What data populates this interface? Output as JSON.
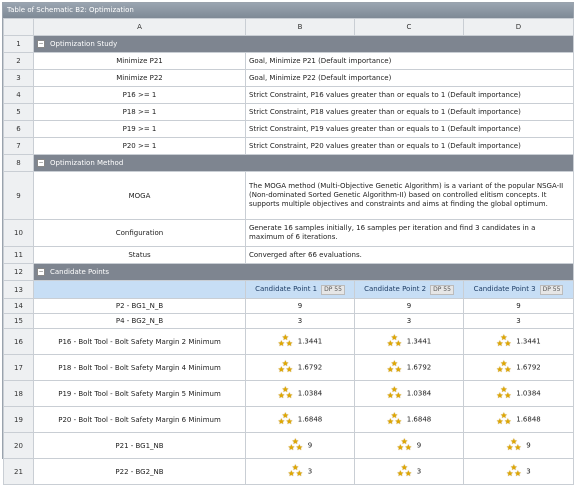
{
  "window": {
    "title": "Table of Schematic B2: Optimization"
  },
  "columns": [
    "A",
    "B",
    "C",
    "D"
  ],
  "sections": {
    "optimization_study": "Optimization Study",
    "optimization_method": "Optimization Method",
    "candidate_points": "Candidate Points"
  },
  "row_numbers": [
    "1",
    "2",
    "3",
    "4",
    "5",
    "6",
    "7",
    "8",
    "9",
    "10",
    "11",
    "12",
    "13",
    "14",
    "15",
    "16",
    "17",
    "18",
    "19",
    "20",
    "21"
  ],
  "study": [
    {
      "name": "Minimize P21",
      "desc": "Goal, Minimize P21 (Default importance)"
    },
    {
      "name": "Minimize P22",
      "desc": "Goal, Minimize P22 (Default importance)"
    },
    {
      "name": "P16 >= 1",
      "desc": "Strict Constraint, P16 values greater than or equals to 1 (Default importance)"
    },
    {
      "name": "P18 >= 1",
      "desc": "Strict Constraint, P18 values greater than or equals to 1 (Default importance)"
    },
    {
      "name": "P19 >= 1",
      "desc": "Strict Constraint, P19 values greater than or equals to 1 (Default importance)"
    },
    {
      "name": "P20 >= 1",
      "desc": "Strict Constraint, P20 values greater than or equals to 1 (Default importance)"
    }
  ],
  "method": [
    {
      "name": "MOGA",
      "desc": "The MOGA method (Multi-Objective Genetic Algorithm) is a variant of the popular NSGA-II (Non-dominated Sorted Genetic Algorithm-II) based on controlled elitism concepts. It supports multiple objectives and constraints and aims at finding the global optimum."
    },
    {
      "name": "Configuration",
      "desc": "Generate 16 samples initially, 16 samples per iteration and find 3 candidates in a maximum of 6 iterations."
    },
    {
      "name": "Status",
      "desc": "Converged after 66 evaluations."
    }
  ],
  "candidates": {
    "headers": [
      {
        "label": "Candidate Point 1",
        "badge": "DP 55"
      },
      {
        "label": "Candidate Point 2",
        "badge": "DP 55"
      },
      {
        "label": "Candidate Point 3",
        "badge": "DP 55"
      }
    ],
    "rows": [
      {
        "name": "P2 - BG1_N_B",
        "values": [
          "9",
          "9",
          "9"
        ],
        "rating": false
      },
      {
        "name": "P4 - BG2_N_B",
        "values": [
          "3",
          "3",
          "3"
        ],
        "rating": false
      },
      {
        "name": "P16 - Bolt Tool - Bolt Safety Margin 2 Minimum",
        "values": [
          "1.3441",
          "1.3441",
          "1.3441"
        ],
        "rating": true
      },
      {
        "name": "P18 - Bolt Tool - Bolt Safety Margin 4 Minimum",
        "values": [
          "1.6792",
          "1.6792",
          "1.6792"
        ],
        "rating": true
      },
      {
        "name": "P19 - Bolt Tool - Bolt Safety Margin 5 Minimum",
        "values": [
          "1.0384",
          "1.0384",
          "1.0384"
        ],
        "rating": true
      },
      {
        "name": "P20 - Bolt Tool - Bolt Safety Margin 6 Minimum",
        "values": [
          "1.6848",
          "1.6848",
          "1.6848"
        ],
        "rating": true
      },
      {
        "name": "P21 - BG1_NB",
        "values": [
          "9",
          "9",
          "9"
        ],
        "rating": true
      },
      {
        "name": "P22 - BG2_NB",
        "values": [
          "3",
          "3",
          "3"
        ],
        "rating": true
      }
    ]
  },
  "icons": {
    "collapse": "minus-box-icon",
    "rating": "three-stars-icon",
    "star_color": "#e0a800"
  }
}
